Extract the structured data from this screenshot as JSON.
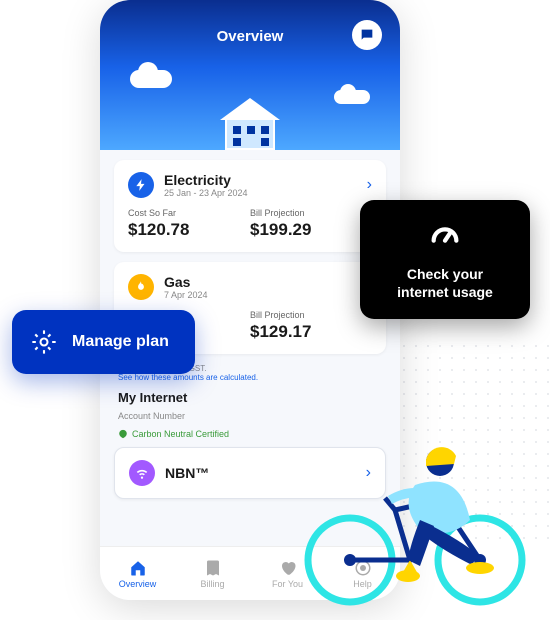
{
  "hero": {
    "title": "Overview"
  },
  "services": [
    {
      "id": "electricity",
      "name": "Electricity",
      "period": "25 Jan - 23 Apr 2024",
      "cost_label": "Cost So Far",
      "cost_value": "$120.78",
      "proj_label": "Bill Projection",
      "proj_value": "$199.29"
    },
    {
      "id": "gas",
      "name": "Gas",
      "period": "7 Apr 2024",
      "proj_label": "Bill Projection",
      "proj_value": "$129.17"
    }
  ],
  "disclaimer": {
    "line1": "Figures inclusive of GST.",
    "link": "See how these amounts are calculated."
  },
  "internet": {
    "heading": "My Internet",
    "account_label": "Account Number",
    "cert": "Carbon Neutral Certified",
    "nbn_label": "NBN™"
  },
  "tabs": [
    {
      "label": "Overview",
      "icon": "home-icon",
      "active": true
    },
    {
      "label": "Billing",
      "icon": "billing-icon",
      "active": false
    },
    {
      "label": "For You",
      "icon": "heart-icon",
      "active": false
    },
    {
      "label": "Help",
      "icon": "help-icon",
      "active": false
    }
  ],
  "callouts": {
    "manage_plan": "Manage plan",
    "internet_usage": "Check your internet usage"
  }
}
